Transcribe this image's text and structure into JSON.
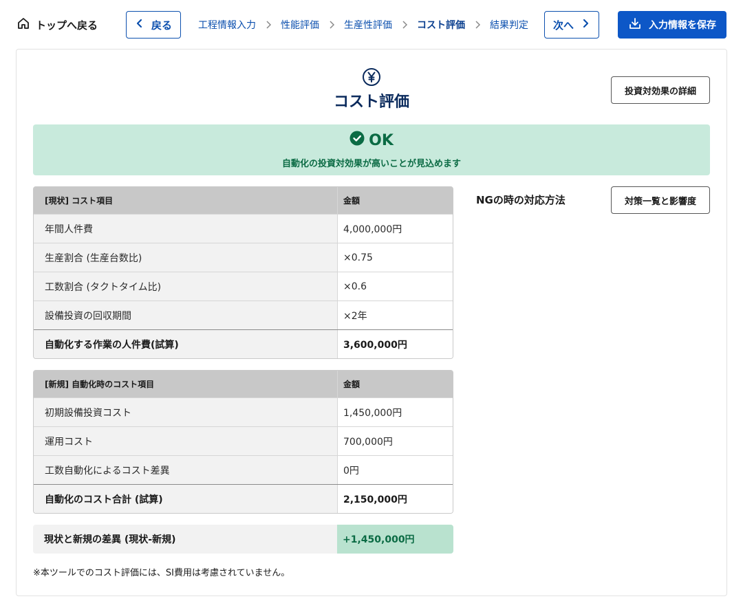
{
  "nav": {
    "home_label": "トップへ戻る",
    "back_label": "戻る",
    "next_label": "次へ",
    "save_label": "入力情報を保存",
    "steps": [
      "工程情報入力",
      "性能評価",
      "生産性評価",
      "コスト評価",
      "結果判定"
    ],
    "current_step": "コスト評価"
  },
  "page": {
    "title": "コスト評価",
    "detail_button": "投資対効果の詳細"
  },
  "result": {
    "status": "OK",
    "message": "自動化の投資対効果が高いことが見込めます"
  },
  "current_costs": {
    "header": [
      "[現状] コスト項目",
      "金額"
    ],
    "rows": [
      [
        "年間人件費",
        "4,000,000円"
      ],
      [
        "生産割合 (生産台数比)",
        "×0.75"
      ],
      [
        "工数割合 (タクトタイム比)",
        "×0.6"
      ],
      [
        "設備投資の回収期間",
        "×2年"
      ]
    ],
    "total": [
      "自動化する作業の人件費(試算)",
      "3,600,000円"
    ]
  },
  "new_costs": {
    "header": [
      "[新規] 自動化時のコスト項目",
      "金額"
    ],
    "rows": [
      [
        "初期設備投資コスト",
        "1,450,000円"
      ],
      [
        "運用コスト",
        "700,000円"
      ],
      [
        "工数自動化によるコスト差異",
        "0円"
      ]
    ],
    "total": [
      "自動化のコスト合計 (試算)",
      "2,150,000円"
    ]
  },
  "difference": {
    "label": "現状と新規の差異 (現状-新規)",
    "value": "+1,450,000円"
  },
  "note": "※本ツールでのコスト評価には、SI費用は考慮されていません。",
  "ng": {
    "title": "NGの時の対応方法",
    "button": "対策一覧と影響度"
  },
  "colors": {
    "primary": "#0d57c7",
    "ok_bg": "#c8eadc",
    "ok_text": "#0b6b44"
  }
}
